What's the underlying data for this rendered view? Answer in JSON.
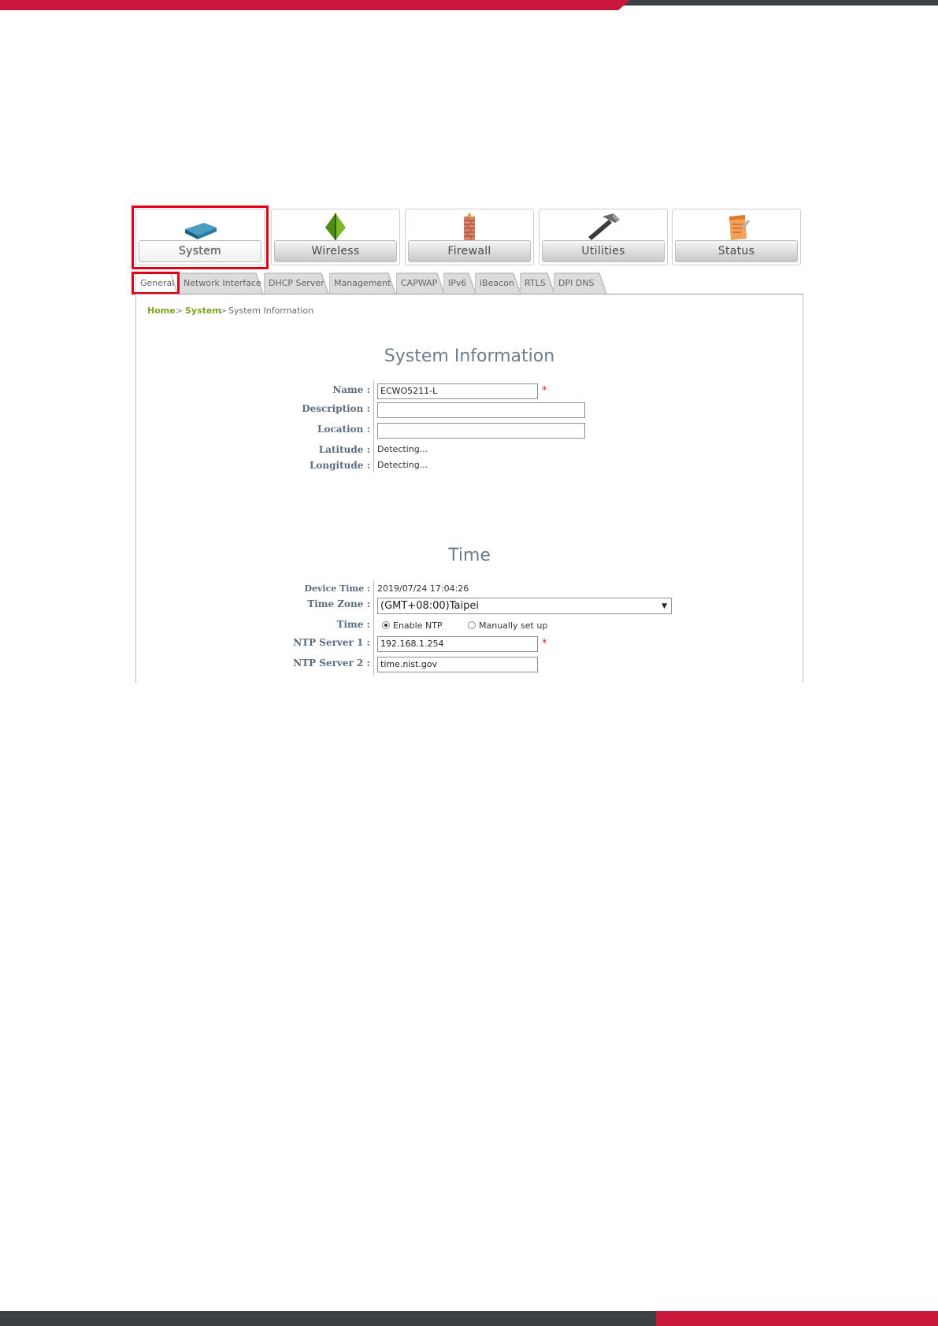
{
  "brand_colors": {
    "primary_red": "#c8193a",
    "dark_gray": "#3d4043"
  },
  "main_nav": [
    {
      "label": "System",
      "icon": "router-icon",
      "active": true
    },
    {
      "label": "Wireless",
      "icon": "antenna-icon",
      "active": false
    },
    {
      "label": "Firewall",
      "icon": "firewall-icon",
      "active": false
    },
    {
      "label": "Utilities",
      "icon": "hammer-icon",
      "active": false
    },
    {
      "label": "Status",
      "icon": "notepad-icon",
      "active": false
    }
  ],
  "sub_tabs": [
    "General",
    "Network Interface",
    "DHCP Server",
    "Management",
    "CAPWAP",
    "IPv6",
    "iBeacon",
    "RTLS",
    "DPI DNS"
  ],
  "active_sub_tab": "General",
  "breadcrumb": {
    "home": "Home",
    "sep1": ">",
    "system": "System",
    "sep2": ">",
    "page": "System Information"
  },
  "system_information": {
    "title": "System Information",
    "name_label": "Name :",
    "name_value": "ECWO5211-L",
    "required_mark": "*",
    "description_label": "Description :",
    "description_value": "",
    "location_label": "Location :",
    "location_value": "",
    "latitude_label": "Latitude :",
    "latitude_value": "Detecting...",
    "longitude_label": "Longitude :",
    "longitude_value": "Detecting..."
  },
  "time": {
    "title": "Time",
    "device_time_label": "Device Time :",
    "device_time_value": "2019/07/24 17:04:26",
    "time_zone_label": "Time Zone :",
    "time_zone_value": "(GMT+08:00)Taipei",
    "time_label": "Time :",
    "enable_ntp_label": "Enable NTP",
    "manual_label": "Manually set up",
    "selected_mode": "Enable NTP",
    "ntp1_label": "NTP Server 1 :",
    "ntp1_value": "192.168.1.254",
    "ntp2_label": "NTP Server 2 :",
    "ntp2_value": "time.nist.gov"
  }
}
